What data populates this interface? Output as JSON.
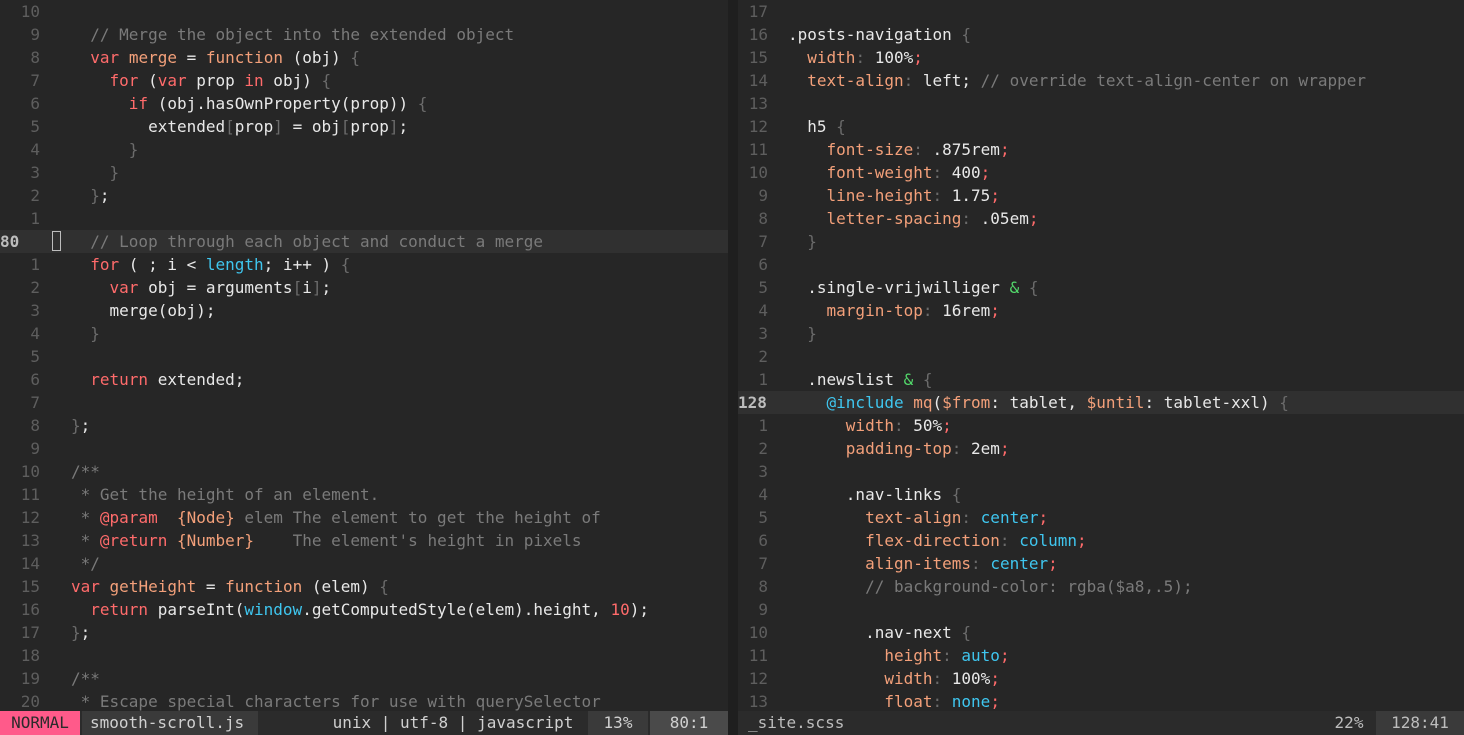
{
  "left_pane": {
    "lines": [
      {
        "num": "10",
        "code": ""
      },
      {
        "num": "9",
        "code": "  // Merge the object into the extended object"
      },
      {
        "num": "8",
        "code": "  var merge = function (obj) {"
      },
      {
        "num": "7",
        "code": "    for (var prop in obj) {"
      },
      {
        "num": "6",
        "code": "      if (obj.hasOwnProperty(prop)) {"
      },
      {
        "num": "5",
        "code": "        extended[prop] = obj[prop];"
      },
      {
        "num": "4",
        "code": "      }"
      },
      {
        "num": "3",
        "code": "    }"
      },
      {
        "num": "2",
        "code": "  };"
      },
      {
        "num": "1",
        "code": ""
      },
      {
        "num": "80",
        "code": "  // Loop through each object and conduct a merge",
        "current": true
      },
      {
        "num": "1",
        "code": "  for ( ; i < length; i++ ) {"
      },
      {
        "num": "2",
        "code": "    var obj = arguments[i];"
      },
      {
        "num": "3",
        "code": "    merge(obj);"
      },
      {
        "num": "4",
        "code": "  }"
      },
      {
        "num": "5",
        "code": ""
      },
      {
        "num": "6",
        "code": "  return extended;"
      },
      {
        "num": "7",
        "code": ""
      },
      {
        "num": "8",
        "code": "};"
      },
      {
        "num": "9",
        "code": ""
      },
      {
        "num": "10",
        "code": "/**"
      },
      {
        "num": "11",
        "code": " * Get the height of an element."
      },
      {
        "num": "12",
        "code": " * @param  {Node} elem The element to get the height of"
      },
      {
        "num": "13",
        "code": " * @return {Number}    The element's height in pixels"
      },
      {
        "num": "14",
        "code": " */"
      },
      {
        "num": "15",
        "code": "var getHeight = function (elem) {"
      },
      {
        "num": "16",
        "code": "  return parseInt(window.getComputedStyle(elem).height, 10);"
      },
      {
        "num": "17",
        "code": "};"
      },
      {
        "num": "18",
        "code": ""
      },
      {
        "num": "19",
        "code": "/**"
      },
      {
        "num": "20",
        "code": " * Escape special characters for use with querySelector"
      }
    ]
  },
  "right_pane": {
    "lines": [
      {
        "num": "17",
        "code": ""
      },
      {
        "num": "16",
        "code": ".posts-navigation {"
      },
      {
        "num": "15",
        "code": "  width: 100%;"
      },
      {
        "num": "14",
        "code": "  text-align: left; // override text-align-center on wrapper"
      },
      {
        "num": "13",
        "code": ""
      },
      {
        "num": "12",
        "code": "  h5 {"
      },
      {
        "num": "11",
        "code": "    font-size: .875rem;"
      },
      {
        "num": "10",
        "code": "    font-weight: 400;"
      },
      {
        "num": "9",
        "code": "    line-height: 1.75;"
      },
      {
        "num": "8",
        "code": "    letter-spacing: .05em;"
      },
      {
        "num": "7",
        "code": "  }"
      },
      {
        "num": "6",
        "code": ""
      },
      {
        "num": "5",
        "code": "  .single-vrijwilliger & {"
      },
      {
        "num": "4",
        "code": "    margin-top: 16rem;"
      },
      {
        "num": "3",
        "code": "  }"
      },
      {
        "num": "2",
        "code": ""
      },
      {
        "num": "1",
        "code": "  .newslist & {"
      },
      {
        "num": "128",
        "code": "    @include mq($from: tablet, $until: tablet-xxl) {",
        "current": true
      },
      {
        "num": "1",
        "code": "      width: 50%;"
      },
      {
        "num": "2",
        "code": "      padding-top: 2em;"
      },
      {
        "num": "3",
        "code": ""
      },
      {
        "num": "4",
        "code": "      .nav-links {"
      },
      {
        "num": "5",
        "code": "        text-align: center;"
      },
      {
        "num": "6",
        "code": "        flex-direction: column;"
      },
      {
        "num": "7",
        "code": "        align-items: center;"
      },
      {
        "num": "8",
        "code": "        // background-color: rgba($a8,.5);"
      },
      {
        "num": "9",
        "code": ""
      },
      {
        "num": "10",
        "code": "        .nav-next {"
      },
      {
        "num": "11",
        "code": "          height: auto;"
      },
      {
        "num": "12",
        "code": "          width: 100%;"
      },
      {
        "num": "13",
        "code": "          float: none;"
      }
    ]
  },
  "status_left": {
    "mode": "NORMAL",
    "filename": "smooth-scroll.js",
    "fileinfo": "unix | utf-8 | javascript",
    "percent": "13%",
    "position": "80:1"
  },
  "status_right": {
    "filename": "_site.scss",
    "percent": "22%",
    "position": "128:41"
  },
  "colors": {
    "background": "#262626",
    "mode_badge": "#ff5a8a",
    "keyword": "#ff6b6b",
    "function": "#f3a07a",
    "builtin": "#3fc6ef",
    "operator_amp": "#52d66a",
    "comment": "#7a7a7a"
  }
}
